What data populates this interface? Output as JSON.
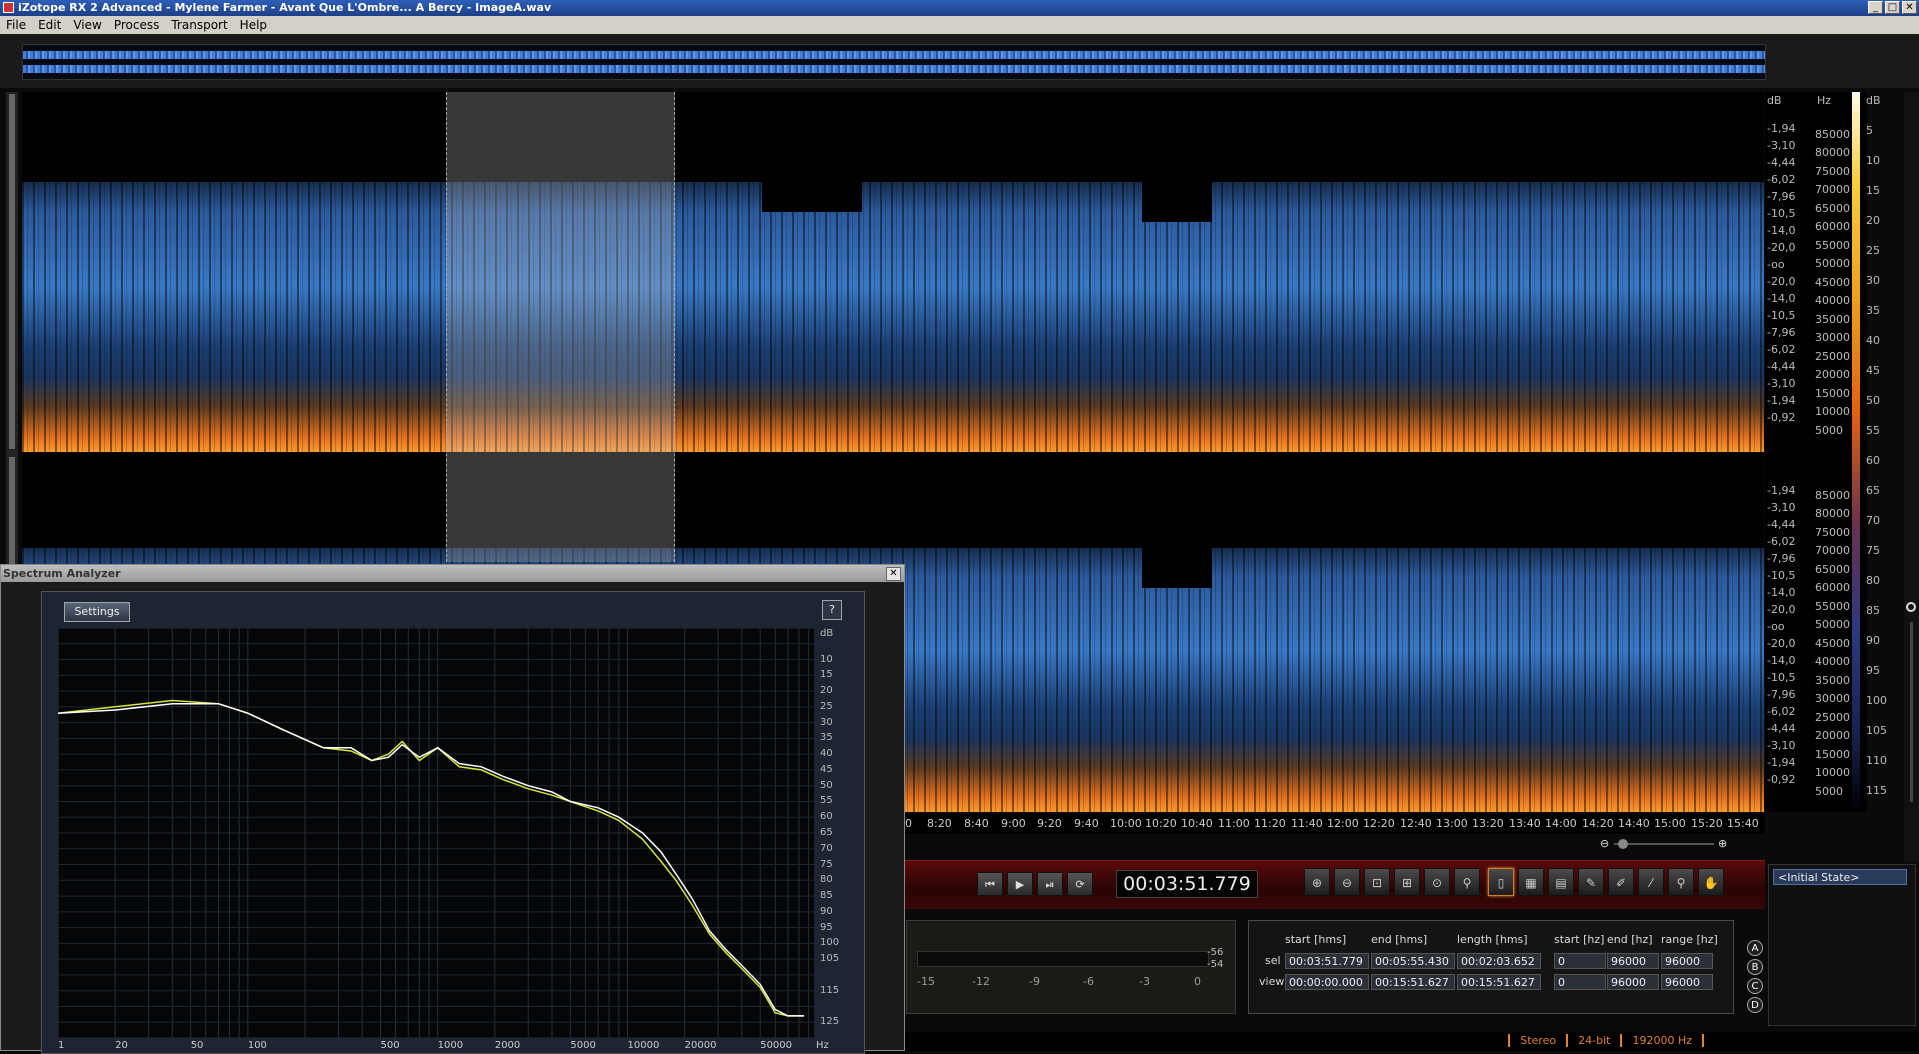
{
  "window": {
    "title": "iZotope RX 2 Advanced - Mylene Farmer - Avant Que L'Ombre... A Bercy - ImageA.wav",
    "btn_min": "_",
    "btn_max": "□",
    "btn_close": "✕"
  },
  "menu": [
    "File",
    "Edit",
    "View",
    "Process",
    "Transport",
    "Help"
  ],
  "db_scale": {
    "header": "dB",
    "ticks": [
      "-1,94",
      "-3,10",
      "-4,44",
      "-6,02",
      "-7,96",
      "-10,5",
      "-14,0",
      "-20,0",
      "-oo",
      "-20,0",
      "-14,0",
      "-10,5",
      "-7,96",
      "-6,02",
      "-4,44",
      "-3,10",
      "-1,94",
      "-0,92"
    ]
  },
  "db_scale2": {
    "ticks": [
      "-1,94",
      "-3,10",
      "-4,44",
      "-6,02",
      "-7,96",
      "-10,5",
      "-14,0",
      "-20,0",
      "-oo",
      "-20,0",
      "-14,0",
      "-10,5",
      "-7,96",
      "-6,02",
      "-4,44",
      "-3,10",
      "-1,94",
      "-0,92"
    ]
  },
  "hz_scale": {
    "header": "Hz",
    "ticks": [
      "85000",
      "80000",
      "75000",
      "70000",
      "65000",
      "60000",
      "55000",
      "50000",
      "45000",
      "40000",
      "35000",
      "30000",
      "25000",
      "20000",
      "15000",
      "10000",
      "5000"
    ]
  },
  "hz_scale2": {
    "ticks": [
      "85000",
      "80000",
      "75000",
      "70000",
      "65000",
      "60000",
      "55000",
      "50000",
      "45000",
      "40000",
      "35000",
      "30000",
      "25000",
      "20000",
      "15000",
      "10000",
      "5000"
    ]
  },
  "colorbar_scale": {
    "header": "dB",
    "ticks": [
      "5",
      "10",
      "15",
      "20",
      "25",
      "30",
      "35",
      "40",
      "45",
      "50",
      "55",
      "60",
      "65",
      "70",
      "75",
      "80",
      "85",
      "90",
      "95",
      "100",
      "105",
      "110",
      "115"
    ]
  },
  "time_axis": [
    "0",
    "8:20",
    "8:40",
    "9:00",
    "9:20",
    "9:40",
    "10:00",
    "10:20",
    "10:40",
    "11:00",
    "11:20",
    "11:40",
    "12:00",
    "12:20",
    "12:40",
    "13:00",
    "13:20",
    "13:40",
    "14:00",
    "14:20",
    "14:40",
    "15:00",
    "15:20",
    "15:40"
  ],
  "transport": {
    "time": "00:03:51.779"
  },
  "meter": {
    "labels": [
      "-15",
      "-12",
      "-9",
      "-6",
      "-3",
      "0"
    ],
    "peak_top": "-56",
    "peak_bottom": "-54"
  },
  "selection_info": {
    "headers": [
      "start [hms]",
      "end [hms]",
      "length [hms]",
      "start [hz]",
      "end [hz]",
      "range [hz]"
    ],
    "sel": {
      "label": "sel",
      "start": "00:03:51.779",
      "end": "00:05:55.430",
      "length": "00:02:03.652",
      "start_hz": "0",
      "end_hz": "96000",
      "range_hz": "96000"
    },
    "view": {
      "label": "view",
      "start": "00:00:00.000",
      "end": "00:15:51.627",
      "length": "00:15:51.627",
      "start_hz": "0",
      "end_hz": "96000",
      "range_hz": "96000"
    }
  },
  "history": {
    "item": "<Initial State>"
  },
  "compare_buttons": [
    "A",
    "B",
    "C",
    "D"
  ],
  "status": {
    "channels": "Stereo",
    "bitdepth": "24-bit",
    "samplerate": "192000 Hz"
  },
  "spectrum_analyzer": {
    "title": "Spectrum Analyzer",
    "settings_label": "Settings",
    "help_label": "?",
    "close_label": "✕",
    "db_header": "dB",
    "db_ticks": [
      "10",
      "15",
      "20",
      "25",
      "30",
      "35",
      "40",
      "45",
      "50",
      "55",
      "60",
      "65",
      "70",
      "75",
      "80",
      "85",
      "90",
      "95",
      "100",
      "105",
      "115",
      "125"
    ],
    "freq_ticks": [
      "1",
      "20",
      "50",
      "100",
      "500",
      "1000",
      "2000",
      "5000",
      "10000",
      "20000",
      "50000",
      "Hz"
    ]
  },
  "chart_data": {
    "type": "line",
    "title": "",
    "xlabel": "Hz",
    "ylabel": "dB",
    "xscale": "log",
    "xlim": [
      10,
      96000
    ],
    "ylim": [
      0,
      130
    ],
    "series": [
      {
        "color": "#d8e43a",
        "x": [
          10,
          20,
          40,
          70,
          100,
          150,
          250,
          350,
          450,
          550,
          650,
          800,
          1000,
          1300,
          1700,
          2200,
          3000,
          4000,
          5000,
          7000,
          9000,
          12000,
          15000,
          18000,
          22000,
          27000,
          33000,
          40000,
          50000,
          60000,
          70000,
          85000
        ],
        "y": [
          27,
          25,
          23,
          24,
          27,
          32,
          38,
          39,
          42,
          40,
          36,
          42,
          38,
          44,
          45,
          48,
          51,
          53,
          55,
          58,
          61,
          67,
          74,
          80,
          88,
          97,
          103,
          108,
          114,
          122,
          123,
          123
        ]
      },
      {
        "color": "#ffffff",
        "x": [
          10,
          20,
          40,
          70,
          100,
          150,
          250,
          350,
          450,
          550,
          650,
          800,
          1000,
          1300,
          1700,
          2200,
          3000,
          4000,
          5000,
          7000,
          9000,
          12000,
          15000,
          18000,
          22000,
          27000,
          33000,
          40000,
          50000,
          60000,
          70000,
          85000
        ],
        "y": [
          27,
          26,
          24,
          24,
          27,
          32,
          38,
          38,
          42,
          41,
          37,
          41,
          38,
          43,
          44,
          47,
          50,
          52,
          55,
          57,
          60,
          65,
          71,
          78,
          86,
          96,
          102,
          107,
          113,
          121,
          123,
          123
        ]
      }
    ]
  },
  "colors": {
    "accent": "#e08030",
    "selection": "#c8c8c8",
    "spec_blue": "#3a78c4",
    "spec_orange": "#ff9a30"
  }
}
